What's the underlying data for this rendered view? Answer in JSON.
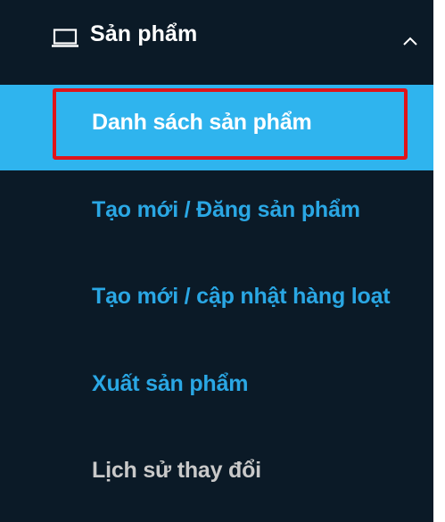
{
  "menu": {
    "header": {
      "label": "Sản phẩm",
      "icon": "laptop-icon",
      "expand_icon": "chevron-up-icon"
    },
    "items": [
      {
        "label": "Danh sách sản phẩm",
        "state": "active"
      },
      {
        "label": "Tạo mới / Đăng sản phẩm",
        "state": "link"
      },
      {
        "label": "Tạo mới / cập nhật hàng loạt",
        "state": "link"
      },
      {
        "label": "Xuất sản phẩm",
        "state": "link"
      },
      {
        "label": "Lịch sử thay đổi",
        "state": "muted"
      }
    ]
  },
  "colors": {
    "sidebar_bg": "#0b1a27",
    "active_bg": "#2fb4ee",
    "link_text": "#2aa7e4",
    "muted_text": "#c9c9c9",
    "highlight_border": "#e0141a"
  }
}
